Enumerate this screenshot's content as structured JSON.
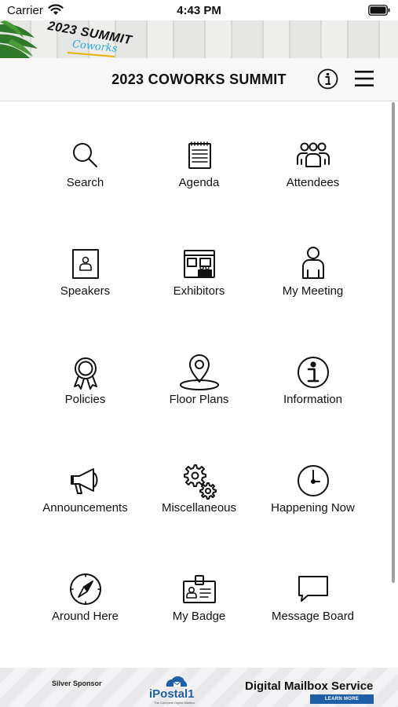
{
  "status_bar": {
    "carrier": "Carrier",
    "time": "4:43 PM"
  },
  "banner": {
    "title": "2023 SUMMIT",
    "script": "Coworks"
  },
  "header": {
    "title": "2023 COWORKS SUMMIT",
    "info_icon": "info-icon",
    "menu_icon": "hamburger-menu-icon"
  },
  "menu": {
    "items": [
      {
        "label": "Search",
        "icon": "search-icon"
      },
      {
        "label": "Agenda",
        "icon": "agenda-icon"
      },
      {
        "label": "Attendees",
        "icon": "attendees-icon"
      },
      {
        "label": "Speakers",
        "icon": "speakers-icon"
      },
      {
        "label": "Exhibitors",
        "icon": "exhibitors-icon"
      },
      {
        "label": "My Meeting",
        "icon": "my-meeting-icon"
      },
      {
        "label": "Policies",
        "icon": "policies-icon"
      },
      {
        "label": "Floor Plans",
        "icon": "floor-plans-icon"
      },
      {
        "label": "Information",
        "icon": "information-icon"
      },
      {
        "label": "Announcements",
        "icon": "announcements-icon"
      },
      {
        "label": "Miscellaneous",
        "icon": "miscellaneous-icon"
      },
      {
        "label": "Happening Now",
        "icon": "happening-now-icon"
      },
      {
        "label": "Around Here",
        "icon": "around-here-icon"
      },
      {
        "label": "My Badge",
        "icon": "my-badge-icon"
      },
      {
        "label": "Message Board",
        "icon": "message-board-icon"
      }
    ]
  },
  "sponsor": {
    "label": "Silver Sponsor",
    "logo_text": "iPostal1",
    "logo_subtext": "The Complete Digital Mailbox",
    "headline": "Digital Mailbox Service",
    "cta": "LEARN MORE"
  },
  "colors": {
    "header_bg": "#f7f7f7",
    "icon_stroke": "#111111",
    "sponsor_blue": "#1f5fa8",
    "banner_script": "#2aa8d8"
  }
}
